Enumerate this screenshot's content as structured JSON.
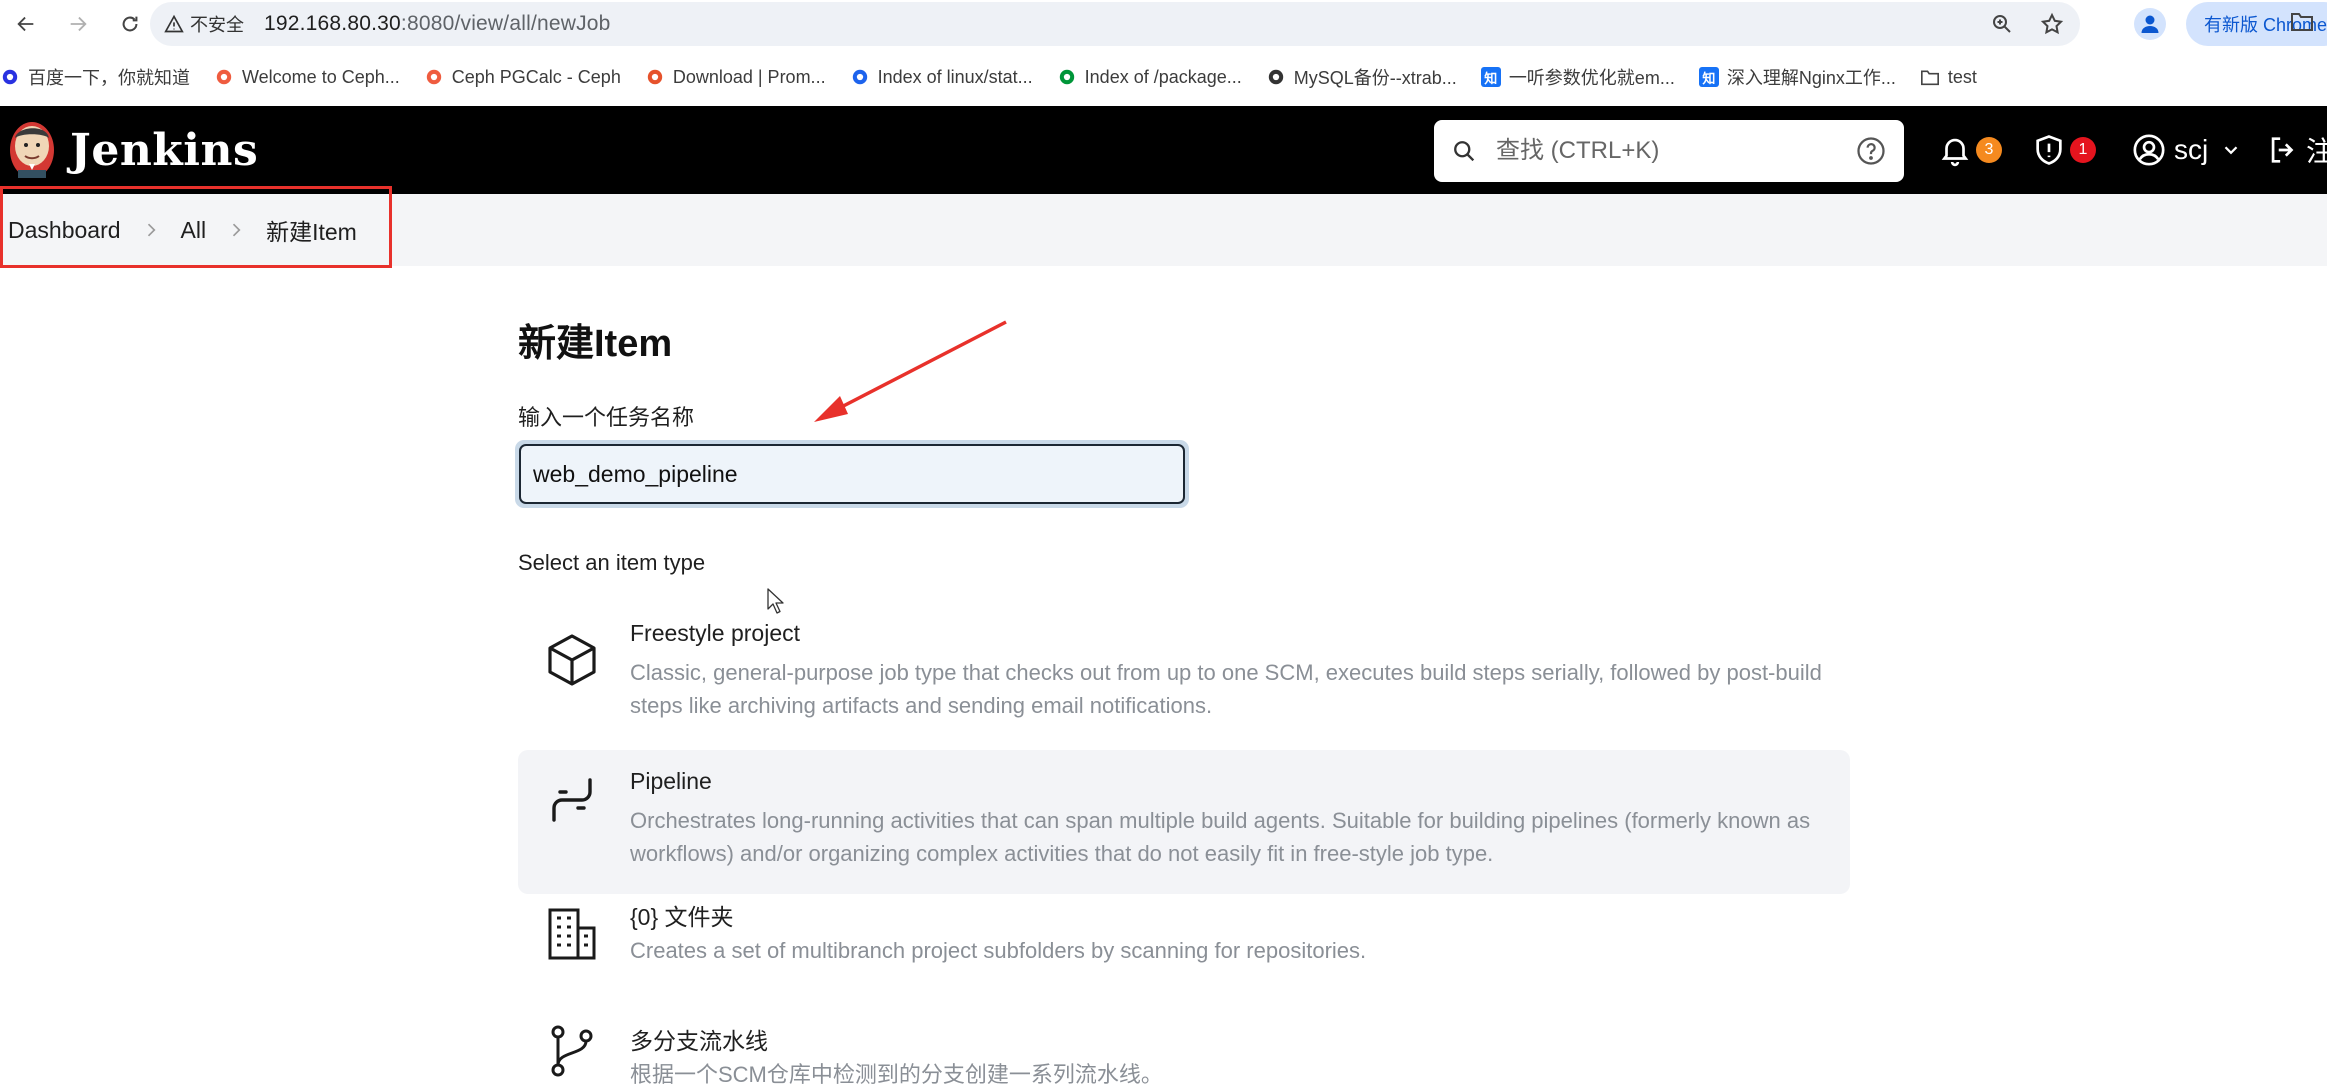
{
  "browser": {
    "security_label": "不安全",
    "url_host": "192.168.80.30",
    "url_rest": ":8080/view/all/newJob",
    "update_label": "有新版 Chrome"
  },
  "bookmarks": [
    {
      "label": "百度一下，你就知道",
      "icon": "baidu-icon",
      "color": "#2932e1"
    },
    {
      "label": "Welcome to Ceph...",
      "icon": "ceph-icon",
      "color": "#ef5c3f"
    },
    {
      "label": "Ceph PGCalc - Ceph",
      "icon": "ceph-icon",
      "color": "#ef5c3f"
    },
    {
      "label": "Download | Prom...",
      "icon": "prometheus-icon",
      "color": "#e6522c"
    },
    {
      "label": "Index of linux/stat...",
      "icon": "docker-icon",
      "color": "#1d63ed"
    },
    {
      "label": "Index of /package...",
      "icon": "nginx-icon",
      "color": "#009639"
    },
    {
      "label": "MySQL备份--xtrab...",
      "icon": "mysql-icon",
      "color": "#333333"
    },
    {
      "label": "一听参数优化就em...",
      "icon": "zhihu-icon",
      "color": "#1772f6",
      "glyph": "知"
    },
    {
      "label": "深入理解Nginx工作...",
      "icon": "zhihu-icon",
      "color": "#1772f6",
      "glyph": "知"
    },
    {
      "label": "test",
      "icon": "folder-icon",
      "color": "#444444"
    }
  ],
  "header": {
    "app_name": "Jenkins",
    "search_placeholder": "查找 (CTRL+K)",
    "notifications_count": "3",
    "security_count": "1",
    "user_name": "scj",
    "logout_label": "注"
  },
  "breadcrumb": [
    "Dashboard",
    "All",
    "新建Item"
  ],
  "main": {
    "title": "新建Item",
    "name_label": "输入一个任务名称",
    "name_value": "web_demo_pipeline",
    "type_label": "Select an item type",
    "item_types": [
      {
        "name": "Freestyle project",
        "desc": "Classic, general-purpose job type that checks out from up to one SCM, executes build steps serially, followed by post-build steps like archiving artifacts and sending email notifications.",
        "icon": "package-icon"
      },
      {
        "name": "Pipeline",
        "desc": "Orchestrates long-running activities that can span multiple build agents. Suitable for building pipelines (formerly known as workflows) and/or organizing complex activities that do not easily fit in free-style job type.",
        "icon": "pipeline-icon"
      },
      {
        "name": "{0} 文件夹",
        "desc": "Creates a set of multibranch project subfolders by scanning for repositories.",
        "icon": "building-icon"
      },
      {
        "name": "多分支流水线",
        "desc": "根据一个SCM仓库中检测到的分支创建一系列流水线。",
        "icon": "git-branch-icon"
      }
    ]
  },
  "colors": {
    "header_bg": "#000000",
    "notification_badge": "#f58a1f",
    "security_badge": "#e5141e",
    "annotation_red": "#e8312b"
  }
}
